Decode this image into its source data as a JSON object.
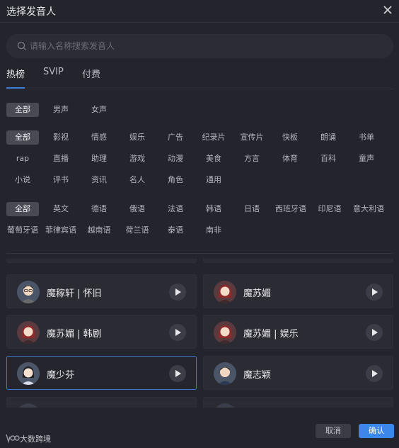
{
  "dialog": {
    "title": "选择发音人"
  },
  "search": {
    "placeholder": "请输入名称搜索发音人"
  },
  "tabs": [
    {
      "label": "热榜",
      "active": true
    },
    {
      "label": "SVIP",
      "active": false
    },
    {
      "label": "付费",
      "active": false
    }
  ],
  "gender_filter": [
    "全部",
    "男声",
    "女声"
  ],
  "category_filter": [
    "全部",
    "影视",
    "情感",
    "娱乐",
    "广告",
    "纪录片",
    "宣传片",
    "快板",
    "朗诵",
    "书单",
    "rap",
    "直播",
    "助理",
    "游戏",
    "动漫",
    "美食",
    "方言",
    "体育",
    "百科",
    "童声",
    "小说",
    "评书",
    "资讯",
    "名人",
    "角色",
    "通用"
  ],
  "language_filter": [
    "全部",
    "英文",
    "德语",
    "俄语",
    "法语",
    "韩语",
    "日语",
    "西班牙语",
    "印尼语",
    "意大利语",
    "葡萄牙语",
    "菲律宾语",
    "越南语",
    "荷兰语",
    "泰语",
    "南非"
  ],
  "voices": [
    {
      "name": "魔稼轩 | 怀旧",
      "avatar": "male-glasses",
      "selected": false
    },
    {
      "name": "魔苏媚",
      "avatar": "female-red",
      "selected": false
    },
    {
      "name": "魔苏媚 | 韩剧",
      "avatar": "female-red",
      "selected": false
    },
    {
      "name": "魔苏媚 | 娱乐",
      "avatar": "female-red",
      "selected": false
    },
    {
      "name": "魔少芬",
      "avatar": "female-dark",
      "selected": true
    },
    {
      "name": "魔志颖",
      "avatar": "male-young",
      "selected": false
    }
  ],
  "footer": {
    "logo_text": "大数跨境",
    "cancel_label": "取消",
    "ok_label": "确认"
  },
  "colors": {
    "accent": "#3d86ea",
    "background": "#24242c",
    "card": "#2b2b33"
  }
}
